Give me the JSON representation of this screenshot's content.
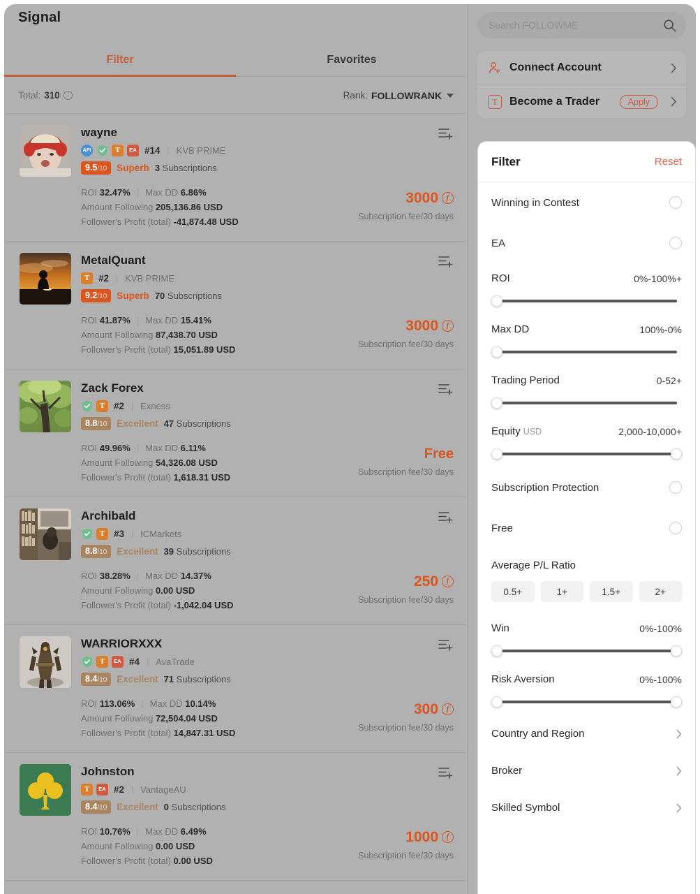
{
  "left": {
    "title": "Signal",
    "tabs": [
      {
        "label": "Filter",
        "active": true
      },
      {
        "label": "Favorites",
        "active": false
      }
    ],
    "meta": {
      "total_label": "Total:",
      "total_value": "310",
      "info_icon": "info-icon",
      "rank_label": "Rank:",
      "rank_value": "FOLLOWRANK"
    },
    "stat_labels": {
      "roi": "ROI",
      "max_dd": "Max DD",
      "amount_following": "Amount Following",
      "followers_profit": "Follower's Profit (total)",
      "subscriptions": "Subscriptions",
      "fee_caption": "Subscription fee/30 days",
      "denominator": "/10"
    },
    "cards": [
      {
        "name": "wayne",
        "avatar": "baby-red-hat-photo",
        "badges": [
          "API",
          "shield",
          "T",
          "EA"
        ],
        "rank": "#14",
        "broker": "KVB PRIME",
        "score": "9.5",
        "grade": "Superb",
        "grade_style": "superb",
        "subs_count": "3",
        "roi": "32.47%",
        "max_dd": "6.86%",
        "amount_following": "205,136.86 USD",
        "followers_profit": "-41,874.48 USD",
        "fee": "3000",
        "fee_is_free": false
      },
      {
        "name": "MetalQuant",
        "avatar": "sunset-silhouette-photo",
        "badges": [
          "T"
        ],
        "rank": "#2",
        "broker": "KVB PRIME",
        "score": "9.2",
        "grade": "Superb",
        "grade_style": "superb",
        "subs_count": "70",
        "roi": "41.87%",
        "max_dd": "15.41%",
        "amount_following": "87,438.70 USD",
        "followers_profit": "15,051.89 USD",
        "fee": "3000",
        "fee_is_free": false
      },
      {
        "name": "Zack Forex",
        "avatar": "green-tree-photo",
        "badges": [
          "shield",
          "T"
        ],
        "rank": "#2",
        "broker": "Exness",
        "score": "8.8",
        "grade": "Excellent",
        "grade_style": "excellent",
        "subs_count": "47",
        "roi": "49.96%",
        "max_dd": "6.11%",
        "amount_following": "54,326.08 USD",
        "followers_profit": "1,618.31 USD",
        "fee": "Free",
        "fee_is_free": true
      },
      {
        "name": "Archibald",
        "avatar": "library-interior-photo",
        "badges": [
          "shield",
          "T"
        ],
        "rank": "#3",
        "broker": "ICMarkets",
        "score": "8.8",
        "grade": "Excellent",
        "grade_style": "excellent",
        "subs_count": "39",
        "roi": "38.28%",
        "max_dd": "14.37%",
        "amount_following": "0.00 USD",
        "followers_profit": "-1,042.04 USD",
        "fee": "250",
        "fee_is_free": false
      },
      {
        "name": "WARRIORXXX",
        "avatar": "armored-warrior-photo",
        "badges": [
          "shield",
          "T",
          "EA"
        ],
        "rank": "#4",
        "broker": "AvaTrade",
        "score": "8.4",
        "grade": "Excellent",
        "grade_style": "excellent",
        "subs_count": "71",
        "roi": "113.06%",
        "max_dd": "10.14%",
        "amount_following": "72,504.04 USD",
        "followers_profit": "14,847.31 USD",
        "fee": "300",
        "fee_is_free": false
      },
      {
        "name": "Johnston",
        "avatar": "green-shamrock-logo",
        "badges": [
          "T",
          "EA"
        ],
        "rank": "#2",
        "broker": "VantageAU",
        "score": "8.4",
        "grade": "Excellent",
        "grade_style": "excellent",
        "subs_count": "0",
        "roi": "10.76%",
        "max_dd": "6.49%",
        "amount_following": "0.00 USD",
        "followers_profit": "0.00 USD",
        "fee": "1000",
        "fee_is_free": false
      }
    ]
  },
  "right": {
    "search": {
      "placeholder": "Search FOLLOWME",
      "icon": "search-icon"
    },
    "actions": [
      {
        "label": "Connect Account",
        "icon": "user-add-icon",
        "pill": null
      },
      {
        "label": "Become a Trader",
        "icon": "trader-t-icon",
        "pill": "Apply"
      }
    ],
    "filter": {
      "title": "Filter",
      "reset": "Reset",
      "toggles_top": [
        {
          "label": "Winning in Contest",
          "checked": false
        },
        {
          "label": "EA",
          "checked": false
        }
      ],
      "sliders_top": [
        {
          "label": "ROI",
          "value": "0%-100%+",
          "thumbs": 1
        },
        {
          "label": "Max DD",
          "value": "100%-0%",
          "thumbs": 1
        },
        {
          "label": "Trading Period",
          "value": "0-52+",
          "thumbs": 1
        },
        {
          "label": "Equity",
          "unit": "USD",
          "value": "2,000-10,000+",
          "thumbs": 2
        }
      ],
      "toggles_mid": [
        {
          "label": "Subscription Protection",
          "checked": false
        },
        {
          "label": "Free",
          "checked": false
        }
      ],
      "pl_ratio": {
        "label": "Average P/L Ratio",
        "options": [
          "0.5+",
          "1+",
          "1.5+",
          "2+"
        ]
      },
      "sliders_bottom": [
        {
          "label": "Win",
          "value": "0%-100%",
          "thumbs": 2
        },
        {
          "label": "Risk Aversion",
          "value": "0%-100%",
          "thumbs": 2
        }
      ],
      "nav_rows": [
        {
          "label": "Country and Region"
        },
        {
          "label": "Broker"
        },
        {
          "label": "Skilled Symbol"
        }
      ]
    }
  }
}
